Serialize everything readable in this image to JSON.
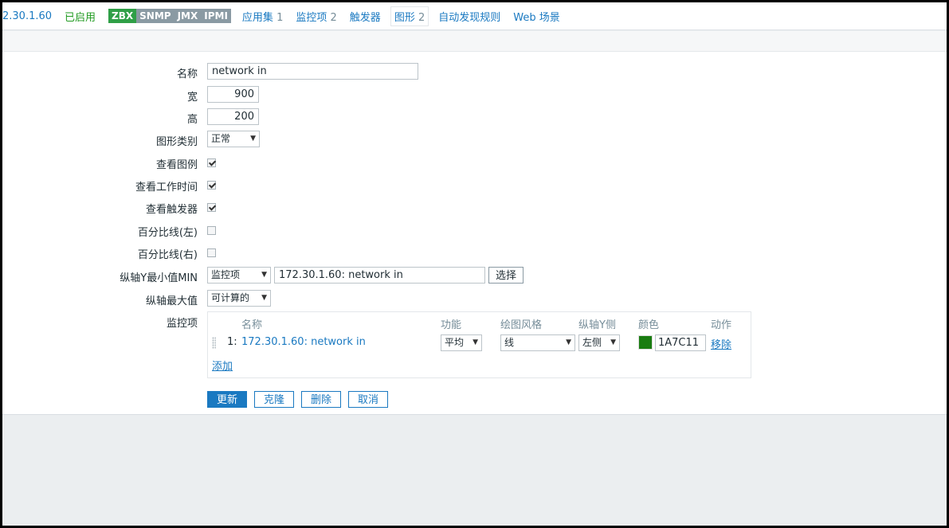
{
  "nav": {
    "host": "2.30.1.60",
    "status": "已启用",
    "badges": [
      "ZBX",
      "SNMP",
      "JMX",
      "IPMI"
    ],
    "applications": {
      "label": "应用集",
      "count": "1"
    },
    "items": {
      "label": "监控项",
      "count": "2"
    },
    "triggers": {
      "label": "触发器"
    },
    "graphs": {
      "label": "图形",
      "count": "2"
    },
    "discovery": {
      "label": "自动发现规则"
    },
    "web": {
      "label": "Web 场景"
    }
  },
  "form": {
    "name_label": "名称",
    "name_value": "network in",
    "width_label": "宽",
    "width_value": "900",
    "height_label": "高",
    "height_value": "200",
    "graph_type_label": "图形类别",
    "graph_type_value": "正常",
    "show_legend_label": "查看图例",
    "show_legend": true,
    "show_work_period_label": "查看工作时间",
    "show_work_period": true,
    "show_triggers_label": "查看触发器",
    "show_triggers": true,
    "percentile_left_label": "百分比线(左)",
    "percentile_left": false,
    "percentile_right_label": "百分比线(右)",
    "percentile_right": false,
    "ymin_label": "纵轴Y最小值MIN",
    "ymin_type": "监控项",
    "ymin_item": "172.30.1.60: network in",
    "ymin_select_button": "选择",
    "ymax_label": "纵轴最大值",
    "ymax_type": "可计算的",
    "items_label": "监控项"
  },
  "items_table": {
    "headers": {
      "name": "名称",
      "function": "功能",
      "style": "绘图风格",
      "yaxis": "纵轴Y侧",
      "color": "颜色",
      "action": "动作"
    },
    "rows": [
      {
        "index": "1:",
        "name": "172.30.1.60: network in",
        "function": "平均",
        "style": "线",
        "yaxis": "左侧",
        "color_hex": "#1A7C11",
        "color_text": "1A7C11",
        "action": "移除"
      }
    ],
    "add_link": "添加"
  },
  "buttons": {
    "update": "更新",
    "clone": "克隆",
    "delete": "删除",
    "cancel": "取消"
  }
}
